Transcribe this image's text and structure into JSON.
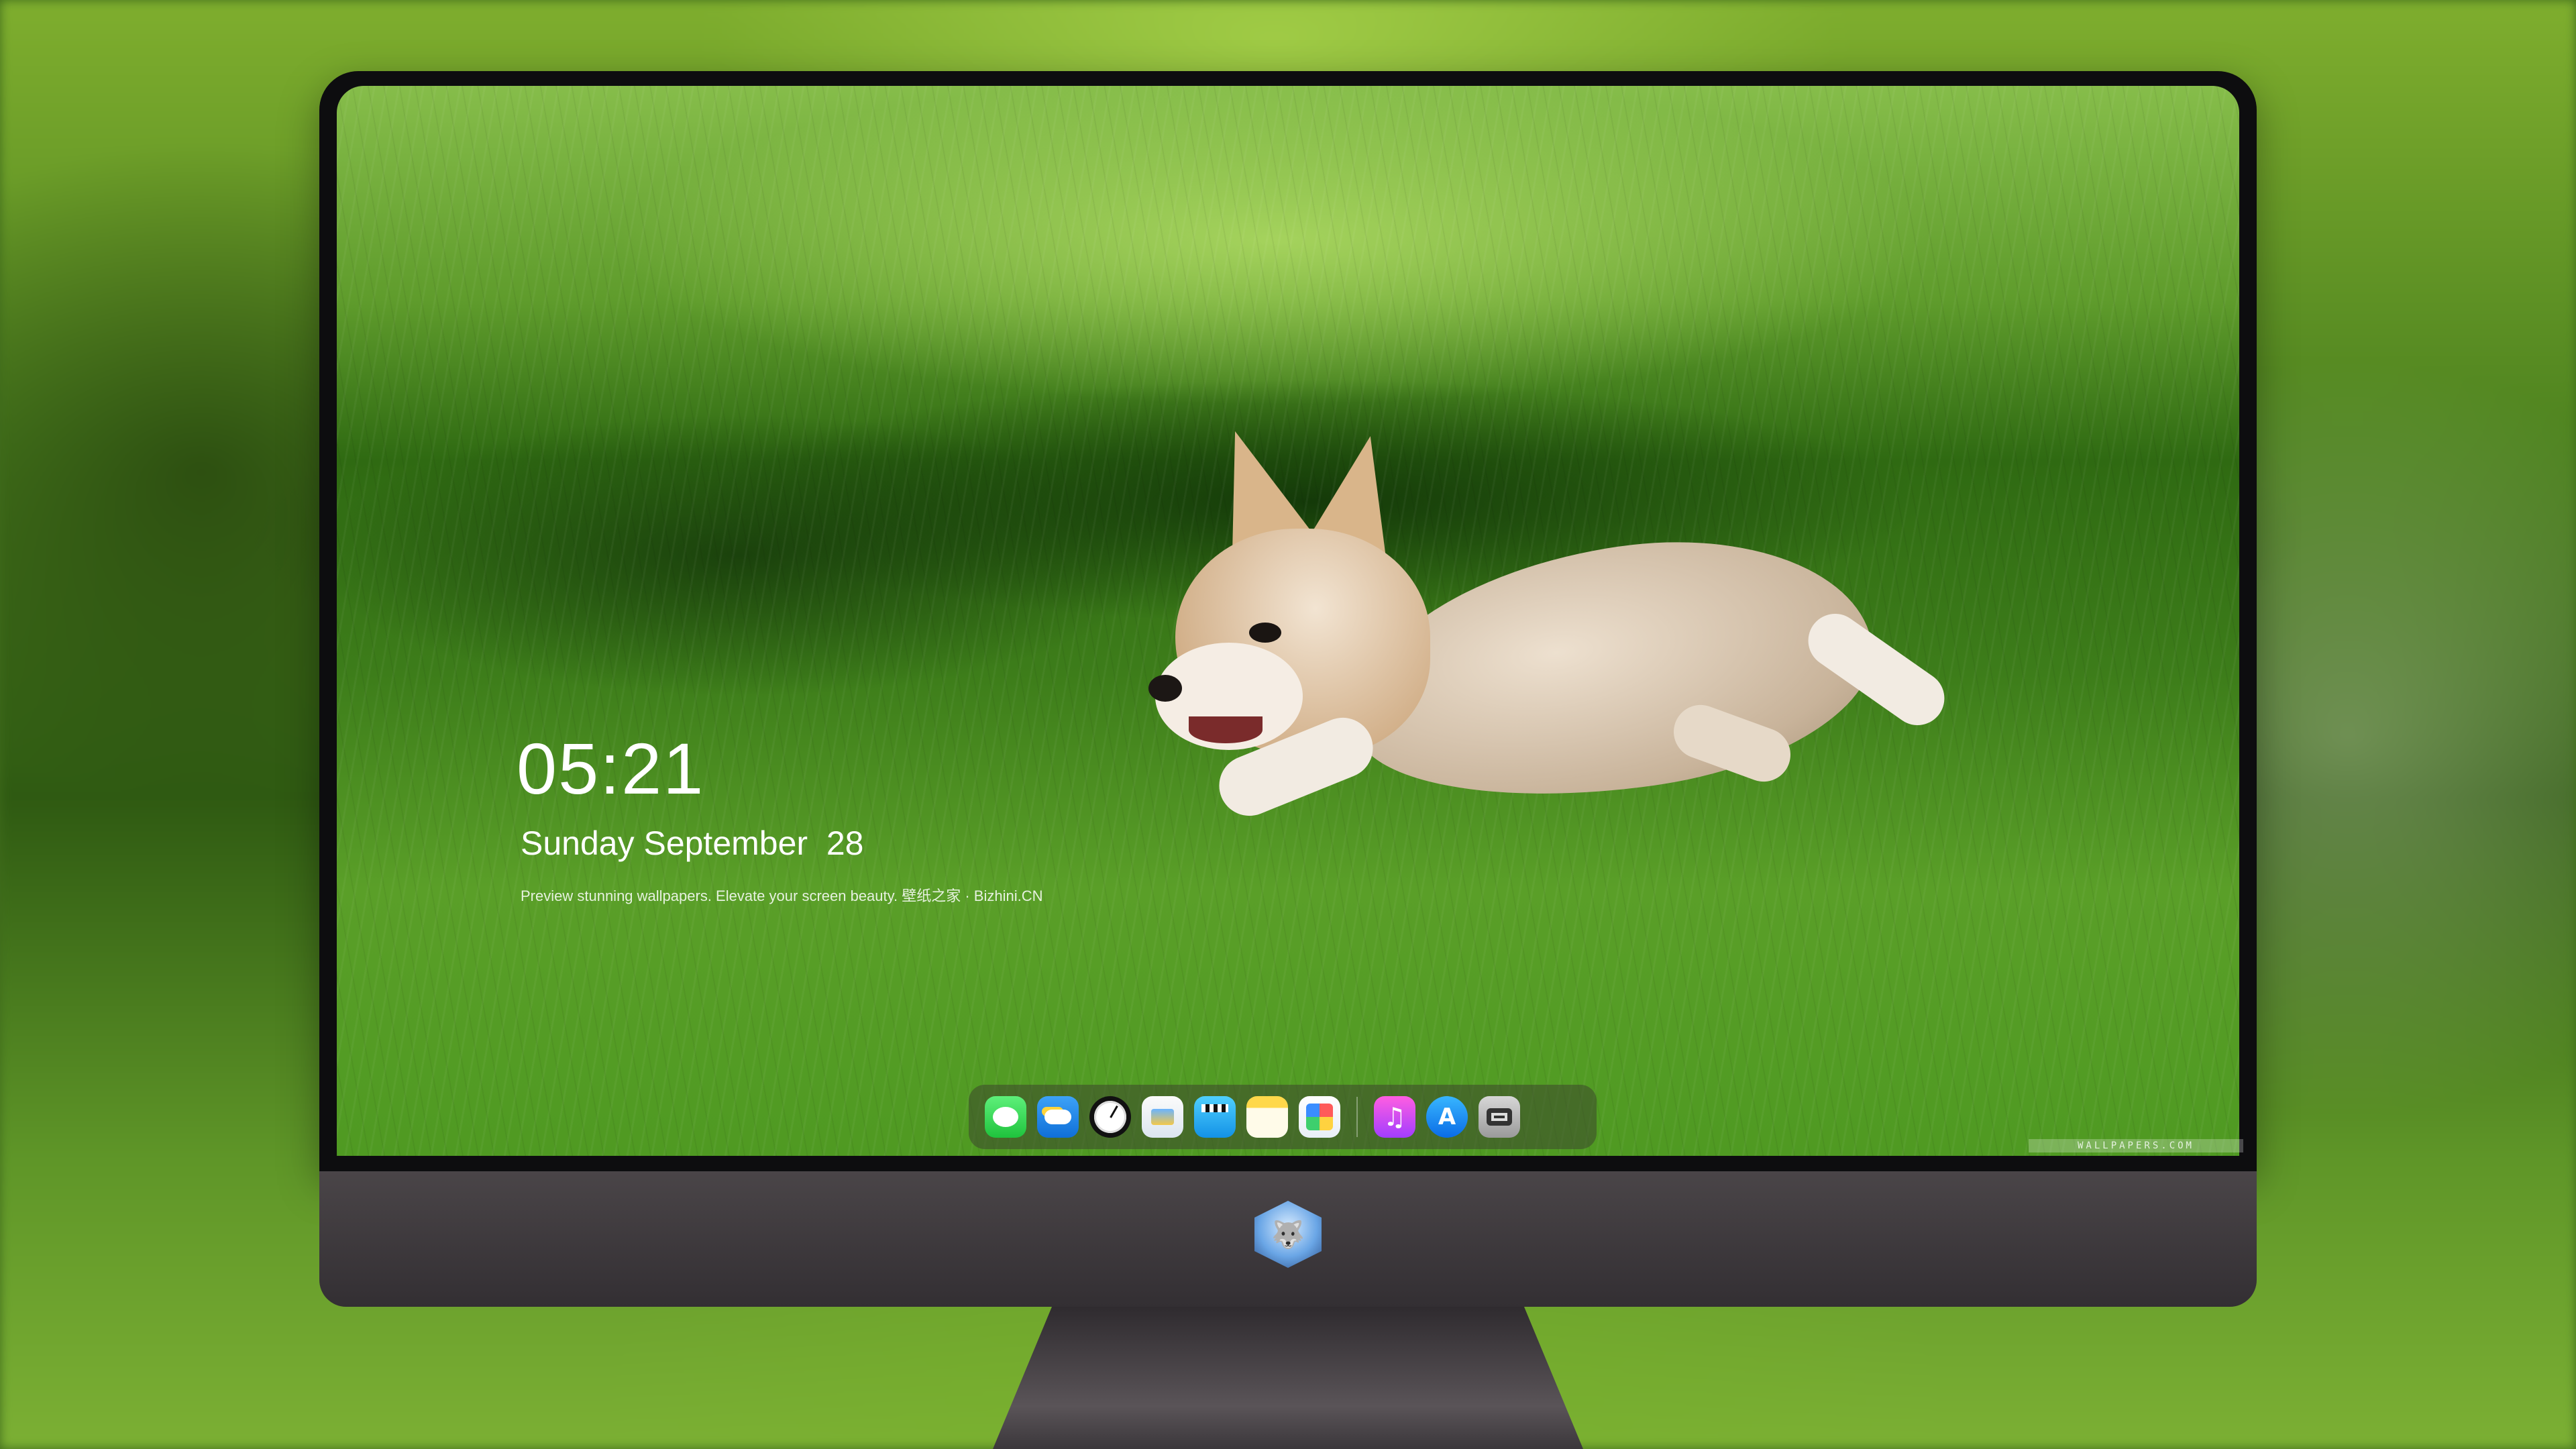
{
  "lock_screen": {
    "time": "05:21",
    "date": "Sunday September  28",
    "tagline": "Preview stunning wallpapers. Elevate your screen beauty. 壁纸之家 · Bizhini.CN"
  },
  "watermark": "WALLPAPERS.COM",
  "dock": {
    "apps": [
      {
        "name": "Messages",
        "icon": "messages-icon"
      },
      {
        "name": "Weather",
        "icon": "weather-icon"
      },
      {
        "name": "Clock",
        "icon": "clock-icon"
      },
      {
        "name": "Preview",
        "icon": "preview-icon"
      },
      {
        "name": "Clips",
        "icon": "clips-icon"
      },
      {
        "name": "Notes",
        "icon": "notes-icon"
      },
      {
        "name": "Photos",
        "icon": "photos-icon"
      },
      {
        "name": "Music",
        "icon": "music-icon",
        "glyph": "♫"
      },
      {
        "name": "App Store",
        "icon": "app-store-icon",
        "glyph": "A"
      },
      {
        "name": "Camera",
        "icon": "camera-icon"
      }
    ]
  },
  "brand_logo": {
    "icon": "fox-mascot-logo",
    "glyph": "🐺"
  },
  "colors": {
    "grass": "#3d7d1a",
    "bezel": "#0d0d0f",
    "chin": "#3f3a3e"
  }
}
